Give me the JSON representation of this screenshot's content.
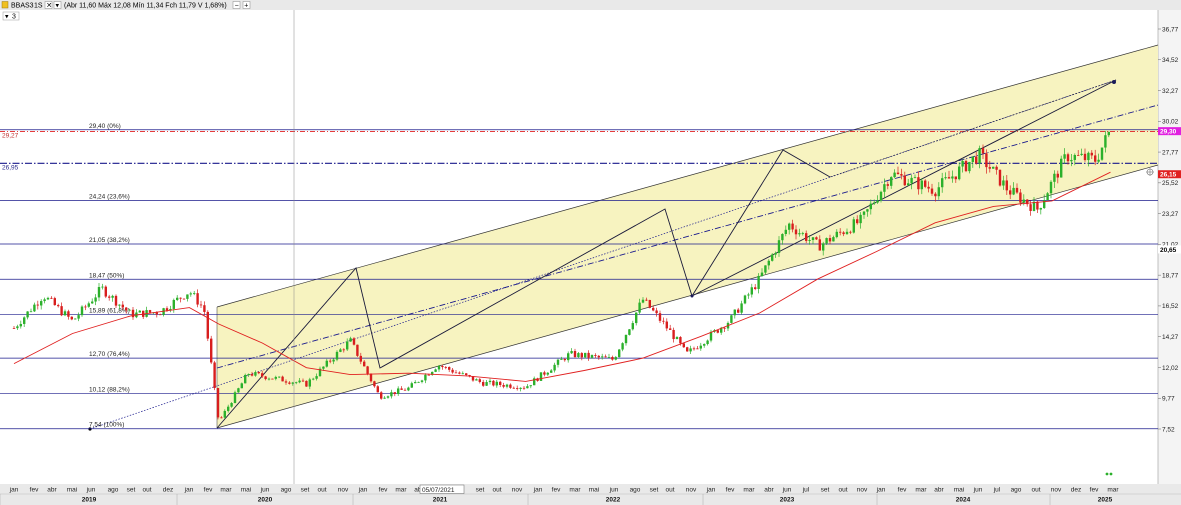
{
  "header": {
    "ticker": "BBAS3",
    "timeframe": "1S",
    "ohlc_text": "(Abr 11,60 Máx 12,08 Mín 11,34 Fch 11,79 V 1,68%)",
    "series_count": "3"
  },
  "price_labels": {
    "right_magenta": "29,30",
    "right_red": "26,15",
    "right_black": "20,65",
    "left_top": "29,27",
    "left_second": "26,95"
  },
  "date_cursor_label": "05/07/2021",
  "colors": {
    "background": "#ffffff",
    "channel_fill": "#f7f3c0",
    "fib_line": "#1a1a8c",
    "ma_line": "#e02020",
    "candle_up": "#2bb02b",
    "candle_down": "#d81e1e",
    "trend_line": "#1a1a3a",
    "magenta_tag": "#e020e0",
    "red_tag": "#e02020",
    "dash_blue": "#1a1a8c"
  },
  "chart_data": {
    "type": "candlestick",
    "ticker": "BBAS3",
    "timeframe": "weekly",
    "title": "",
    "ylim": [
      7.0,
      37.5
    ],
    "y_ticks": [
      "36,77",
      "34,52",
      "32,27",
      "30,02",
      "27,77",
      "25,52",
      "23,27",
      "21,02",
      "18,77",
      "16,52",
      "14,27",
      "12,02",
      "9,77",
      "7,52"
    ],
    "fibonacci_levels": [
      {
        "label": "29,40 (0%)",
        "value": 29.4
      },
      {
        "label": "24,24 (23,6%)",
        "value": 24.24
      },
      {
        "label": "21,05 (38,2%)",
        "value": 21.05
      },
      {
        "label": "18,47 (50%)",
        "value": 18.47
      },
      {
        "label": "15,89 (61,8%)",
        "value": 15.89
      },
      {
        "label": "12,70 (76,4%)",
        "value": 12.7
      },
      {
        "label": "10,12 (88,2%)",
        "value": 10.12
      },
      {
        "label": "7,54 (100%)",
        "value": 7.54
      }
    ],
    "month_labels": [
      "jan",
      "fev",
      "abr",
      "mai",
      "jun",
      "ago",
      "set",
      "out",
      "dez",
      "jan",
      "fev",
      "mar",
      "mai",
      "jun",
      "ago",
      "set",
      "out",
      "nov",
      "jan",
      "fev",
      "mar",
      "abr",
      "m",
      "jul",
      "set",
      "out",
      "nov",
      "jan",
      "fev",
      "mar",
      "mai",
      "jun",
      "ago",
      "set",
      "out",
      "nov",
      "jan",
      "fev",
      "mar",
      "abr",
      "jun",
      "jul",
      "set",
      "out",
      "nov",
      "jan",
      "fev",
      "mar",
      "abr",
      "mai",
      "jun",
      "jul",
      "ago",
      "out",
      "nov",
      "dez",
      "fev",
      "mar",
      "abr"
    ],
    "year_labels": [
      "2019",
      "2020",
      "2021",
      "2022",
      "2023",
      "2024",
      "2025"
    ],
    "price_path": [
      {
        "date": "2019-01",
        "price": 14.9
      },
      {
        "date": "2019-03",
        "price": 17.3
      },
      {
        "date": "2019-05",
        "price": 15.4
      },
      {
        "date": "2019-07",
        "price": 17.8
      },
      {
        "date": "2019-09",
        "price": 15.9
      },
      {
        "date": "2019-11",
        "price": 16.1
      },
      {
        "date": "2020-01",
        "price": 17.6
      },
      {
        "date": "2020-02",
        "price": 16.3
      },
      {
        "date": "2020-03",
        "price": 8.0
      },
      {
        "date": "2020-05",
        "price": 11.6
      },
      {
        "date": "2020-07",
        "price": 11.2
      },
      {
        "date": "2020-09",
        "price": 10.8
      },
      {
        "date": "2020-12",
        "price": 14.0
      },
      {
        "date": "2021-02",
        "price": 9.9
      },
      {
        "date": "2021-04",
        "price": 10.5
      },
      {
        "date": "2021-06",
        "price": 12.2
      },
      {
        "date": "2021-09",
        "price": 10.9
      },
      {
        "date": "2021-12",
        "price": 10.6
      },
      {
        "date": "2022-03",
        "price": 13.0
      },
      {
        "date": "2022-06",
        "price": 12.6
      },
      {
        "date": "2022-08",
        "price": 17.0
      },
      {
        "date": "2022-10",
        "price": 14.5
      },
      {
        "date": "2022-11",
        "price": 13.0
      },
      {
        "date": "2023-02",
        "price": 15.5
      },
      {
        "date": "2023-04",
        "price": 18.5
      },
      {
        "date": "2023-06",
        "price": 22.5
      },
      {
        "date": "2023-08",
        "price": 20.9
      },
      {
        "date": "2023-11",
        "price": 22.8
      },
      {
        "date": "2024-01",
        "price": 26.2
      },
      {
        "date": "2024-04",
        "price": 25.0
      },
      {
        "date": "2024-07",
        "price": 27.6
      },
      {
        "date": "2024-09",
        "price": 25.0
      },
      {
        "date": "2024-11",
        "price": 23.6
      },
      {
        "date": "2025-01",
        "price": 27.5
      },
      {
        "date": "2025-03",
        "price": 27.2
      },
      {
        "date": "2025-04",
        "price": 29.4
      }
    ],
    "moving_average": [
      {
        "date": "2019-01",
        "price": 12.3
      },
      {
        "date": "2019-05",
        "price": 14.5
      },
      {
        "date": "2019-09",
        "price": 15.8
      },
      {
        "date": "2020-01",
        "price": 16.4
      },
      {
        "date": "2020-03",
        "price": 15.2
      },
      {
        "date": "2020-06",
        "price": 13.8
      },
      {
        "date": "2020-09",
        "price": 12.0
      },
      {
        "date": "2020-12",
        "price": 11.5
      },
      {
        "date": "2021-04",
        "price": 11.6
      },
      {
        "date": "2021-08",
        "price": 11.4
      },
      {
        "date": "2021-12",
        "price": 11.0
      },
      {
        "date": "2022-04",
        "price": 11.8
      },
      {
        "date": "2022-08",
        "price": 12.7
      },
      {
        "date": "2022-12",
        "price": 14.3
      },
      {
        "date": "2023-04",
        "price": 16.0
      },
      {
        "date": "2023-08",
        "price": 18.5
      },
      {
        "date": "2023-12",
        "price": 20.5
      },
      {
        "date": "2024-04",
        "price": 22.6
      },
      {
        "date": "2024-08",
        "price": 23.8
      },
      {
        "date": "2024-12",
        "price": 24.2
      },
      {
        "date": "2025-04",
        "price": 26.3
      }
    ]
  }
}
